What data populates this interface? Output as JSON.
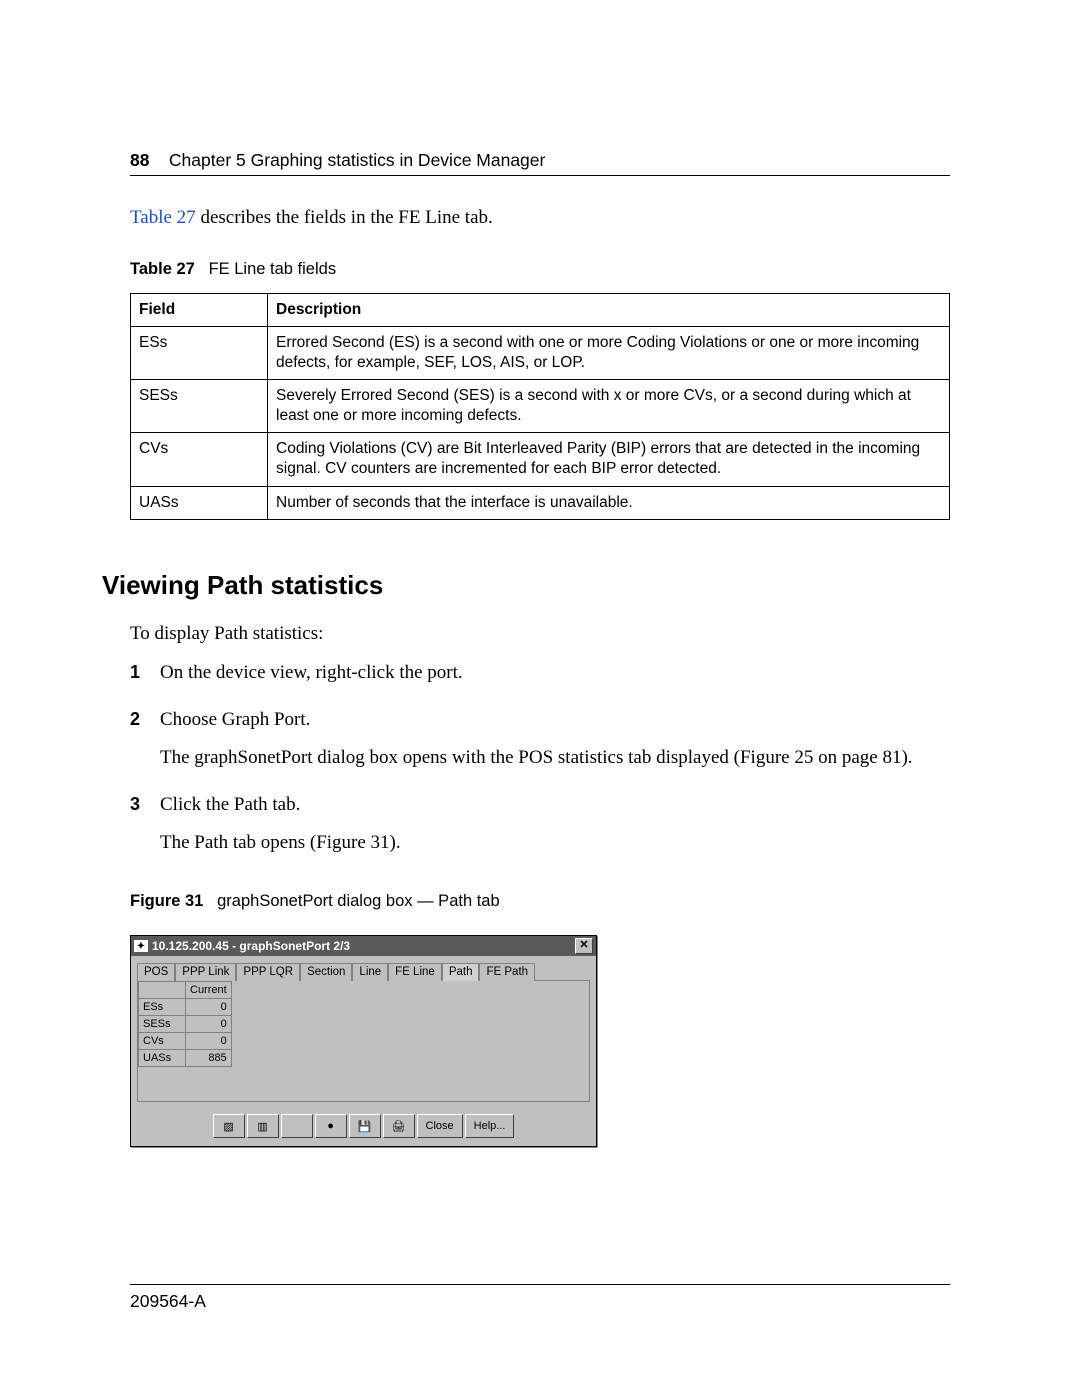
{
  "header": {
    "page_number": "88",
    "chapter": "Chapter 5  Graphing statistics in Device Manager"
  },
  "intro_line": {
    "link": "Table 27",
    "rest": " describes the fields in the FE Line tab."
  },
  "table27": {
    "label": "Table 27",
    "title": "FE Line tab fields",
    "cols": {
      "field": "Field",
      "desc": "Description"
    },
    "rows": [
      {
        "field": "ESs",
        "desc": "Errored Second (ES) is a second with one or more Coding Violations or one or more incoming defects, for example, SEF, LOS, AIS, or LOP."
      },
      {
        "field": "SESs",
        "desc": "Severely Errored Second (SES) is a second with x or more CVs, or a second during which at least one or more incoming defects."
      },
      {
        "field": "CVs",
        "desc": "Coding Violations (CV) are Bit Interleaved Parity (BIP) errors that are detected in the incoming signal. CV counters are incremented for each BIP error detected."
      },
      {
        "field": "UASs",
        "desc": "Number of seconds that the interface is unavailable."
      }
    ]
  },
  "section_heading": "Viewing Path statistics",
  "section_intro": "To display Path statistics:",
  "steps": [
    {
      "num": "1",
      "text": "On the device view, right-click the port."
    },
    {
      "num": "2",
      "text": "Choose Graph Port.",
      "follow": {
        "pre": "The graphSonetPort dialog box opens with the POS statistics tab displayed (",
        "link": "Figure 25 on page 81",
        "post": ")."
      }
    },
    {
      "num": "3",
      "text": "Click the Path tab.",
      "follow2": {
        "pre": "The Path tab opens (",
        "link": "Figure 31",
        "post": ")."
      }
    }
  ],
  "figure31": {
    "label": "Figure 31",
    "title": "graphSonetPort dialog box — Path tab"
  },
  "dialog": {
    "title": "10.125.200.45 - graphSonetPort 2/3",
    "close_glyph": "✕",
    "tabs": [
      "POS",
      "PPP Link",
      "PPP LQR",
      "Section",
      "Line",
      "FE Line",
      "Path",
      "FE Path"
    ],
    "active_tab": "Path",
    "col_header": "Current",
    "rows": [
      {
        "label": "ESs",
        "value": "0"
      },
      {
        "label": "SESs",
        "value": "0"
      },
      {
        "label": "CVs",
        "value": "0"
      },
      {
        "label": "UASs",
        "value": "885"
      }
    ],
    "icons": {
      "areachart": "▨",
      "barchart": "▥",
      "spacer": "",
      "disc": "●",
      "save": "💾",
      "print": "🖨"
    },
    "buttons": {
      "close": "Close",
      "help": "Help..."
    }
  },
  "footer": {
    "docnum": "209564-A"
  },
  "chart_data": {
    "type": "table",
    "title": "Path tab — Current counters",
    "categories": [
      "ESs",
      "SESs",
      "CVs",
      "UASs"
    ],
    "values": [
      0,
      0,
      0,
      885
    ]
  }
}
